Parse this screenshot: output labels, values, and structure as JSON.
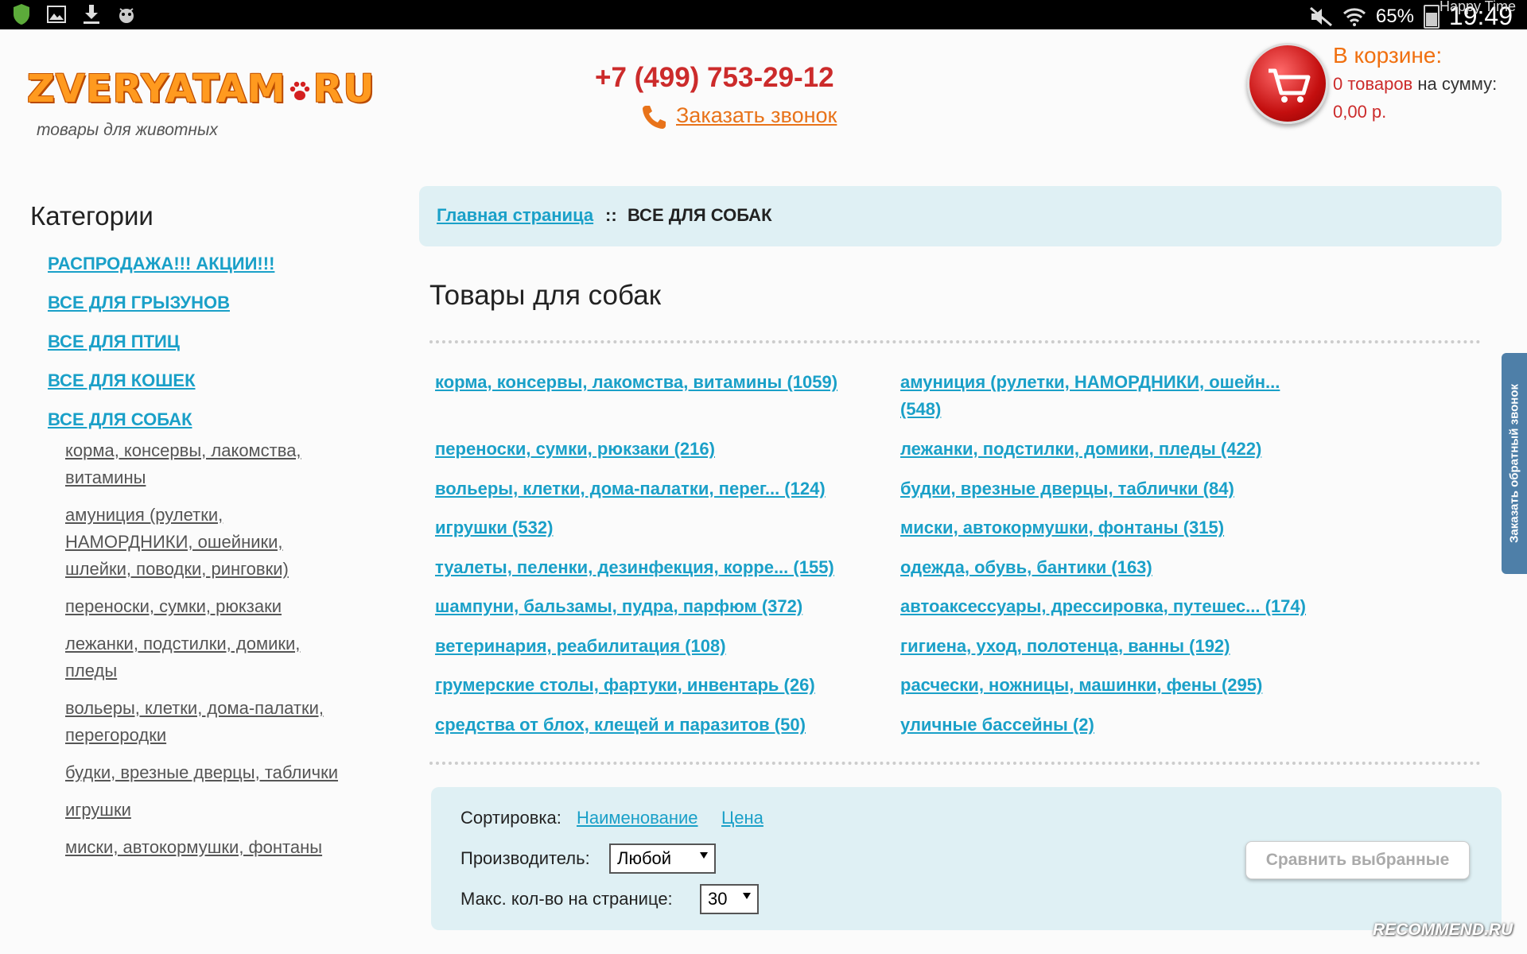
{
  "status_bar": {
    "battery": "65%",
    "battery_level": 0.65,
    "time": "19:49",
    "app_overlay": "Happy Time"
  },
  "header": {
    "logo_text": "ZVERYATAM",
    "logo_domain": "RU",
    "tagline": "товары для животных",
    "phone": "+7 (499) 753-29-12",
    "callback_label": "Заказать звонок",
    "cart": {
      "title": "В корзине:",
      "items": "0 товаров",
      "sum_label": "на сумму:",
      "total": "0,00 р."
    }
  },
  "sidebar": {
    "title": "Категории",
    "top_items": [
      {
        "label": "РАСПРОДАЖА!!! АКЦИИ!!!"
      },
      {
        "label": "ВСЕ ДЛЯ ГРЫЗУНОВ"
      },
      {
        "label": "ВСЕ ДЛЯ ПТИЦ"
      },
      {
        "label": "ВСЕ ДЛЯ КОШЕК"
      },
      {
        "label": "ВСЕ ДЛЯ СОБАК"
      }
    ],
    "sub_items": [
      {
        "label": "корма, консервы, лакомства, витамины"
      },
      {
        "label": "амуниция (рулетки, НАМОРДНИКИ, ошейники, шлейки, поводки, ринговки)"
      },
      {
        "label": "переноски, сумки, рюкзаки"
      },
      {
        "label": "лежанки, подстилки, домики, пледы"
      },
      {
        "label": "вольеры, клетки, дома-палатки, перегородки"
      },
      {
        "label": "будки, врезные дверцы, таблички"
      },
      {
        "label": "игрушки"
      },
      {
        "label": "миски, автокормушки, фонтаны"
      }
    ]
  },
  "breadcrumb": {
    "home": "Главная страница",
    "separator": "::",
    "current": "ВСЕ ДЛЯ СОБАК"
  },
  "main": {
    "title": "Товары для собак",
    "subcategories_left": [
      "корма, консервы, лакомства, витамины (1059)",
      "переноски, сумки, рюкзаки (216)",
      "вольеры, клетки, дома-палатки, перег... (124)",
      "игрушки (532)",
      "туалеты, пеленки, дезинфекция, корре... (155)",
      "шампуни, бальзамы, пудра, парфюм (372)",
      "ветеринария, реабилитация (108)",
      "грумерские столы, фартуки, инвентарь (26)",
      "средства от блох, клещей и паразитов (50)"
    ],
    "subcategories_right": [
      "амуниция (рулетки, НАМОРДНИКИ, ошейн...",
      "(548)",
      "лежанки, подстилки, домики, пледы (422)",
      "будки, врезные дверцы, таблички (84)",
      "миски, автокормушки, фонтаны (315)",
      "одежда, обувь, бантики (163)",
      "автоаксессуары, дрессировка, путешес... (174)",
      "гигиена, уход, полотенца, ванны (192)",
      "расчески, ножницы, машинки, фены (295)",
      "уличные бассейны (2)"
    ]
  },
  "filters": {
    "sort_label": "Сортировка:",
    "sort_name": "Наименование",
    "sort_price": "Цена",
    "maker_label": "Производитель:",
    "maker_value": "Любой",
    "per_page_label": "Макс. кол-во на странице:",
    "per_page_value": "30",
    "compare_button": "Сравнить выбранные"
  },
  "side_tab": "Заказать обратный звонок",
  "watermark": "RECOMMEND.RU",
  "colors": {
    "link": "#1aa0c8",
    "phone": "#cc2b2b",
    "accent_orange": "#f07010",
    "panel_bg": "#dff0f4"
  }
}
